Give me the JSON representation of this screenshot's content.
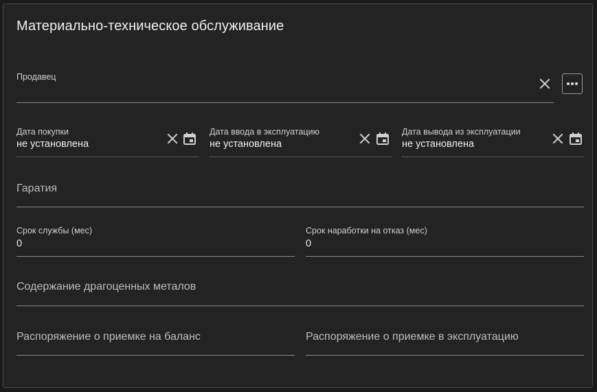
{
  "card": {
    "title": "Материально-техническое обслуживание"
  },
  "vendor": {
    "label": "Продавец",
    "value": ""
  },
  "dates": {
    "purchase": {
      "label": "Дата покупки",
      "value": "не установлена"
    },
    "commission": {
      "label": "Дата ввода в эксплуатацию",
      "value": "не установлена"
    },
    "decommission": {
      "label": "Дата вывода из эксплуатации",
      "value": "не установлена"
    }
  },
  "warranty": {
    "placeholder": "Гаратия"
  },
  "service_life": {
    "label": "Срок службы (мес)",
    "value": "0"
  },
  "mtbf": {
    "label": "Срок наработки на отказ (мес)",
    "value": "0"
  },
  "precious_metals": {
    "placeholder": "Содержание драгоценных металов"
  },
  "balance_order": {
    "placeholder": "Распоряжение о приемке на баланс"
  },
  "operation_order": {
    "placeholder": "Распоряжение о приемке в эксплуатацию"
  },
  "icons": {
    "clear": "close-icon",
    "calendar": "calendar-icon",
    "more": "more-horizontal-icon"
  },
  "colors": {
    "background": "#232323",
    "border": "#4a4a4a",
    "text": "#f0f0f0",
    "muted": "#bdbdbd"
  }
}
